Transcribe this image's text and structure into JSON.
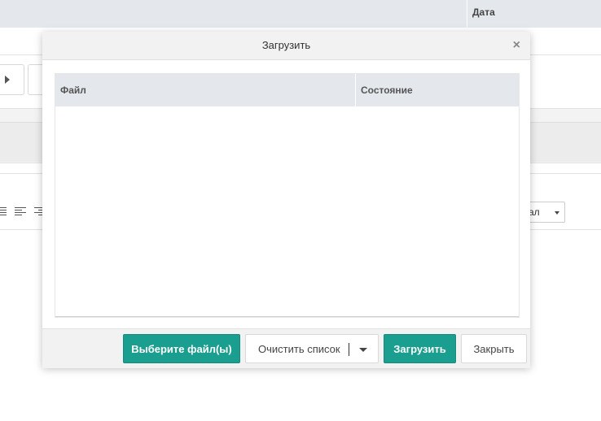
{
  "background": {
    "table": {
      "date_header": "Дата"
    },
    "editor": {
      "font_select_partial": "ал"
    }
  },
  "modal": {
    "title": "Загрузить",
    "grid": {
      "columns": [
        "Файл",
        "Состояние"
      ],
      "rows": []
    },
    "footer": {
      "choose_files_label": "Выберите файл(ы)",
      "clear_list_label": "Очистить список",
      "upload_label": "Загрузить",
      "close_label": "Закрыть"
    }
  },
  "colors": {
    "primary": "#1a9e8f",
    "grid_header": "#e4e8ec",
    "panel": "#f2f2f2"
  },
  "icons": [
    "close-icon",
    "play-icon",
    "chevron-down-icon",
    "align-center-icon",
    "align-left-icon",
    "align-right-icon"
  ]
}
